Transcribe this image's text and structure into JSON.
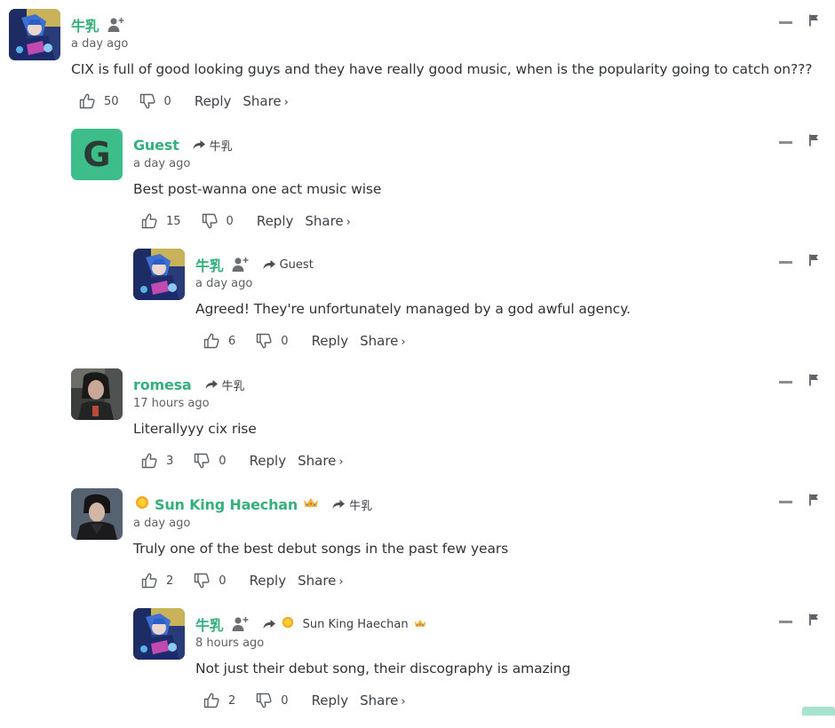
{
  "comments": [
    {
      "name": "牛乳",
      "time": "a day ago",
      "text": "CIX is full of good looking guys and they have really good music, when is the popularity going to catch on???",
      "likes": "50",
      "dislikes": "0",
      "reply": "Reply",
      "share": "Share"
    },
    {
      "avatar_letter": "G",
      "name": "Guest",
      "reply_to": "牛乳",
      "time": "a day ago",
      "text": "Best post-wanna one act music wise",
      "likes": "15",
      "dislikes": "0",
      "reply": "Reply",
      "share": "Share"
    },
    {
      "name": "牛乳",
      "reply_to": "Guest",
      "time": "a day ago",
      "text": "Agreed! They're unfortunately managed by a god awful agency.",
      "likes": "6",
      "dislikes": "0",
      "reply": "Reply",
      "share": "Share"
    },
    {
      "name": "romesa",
      "reply_to": "牛乳",
      "time": "17 hours ago",
      "text": "Literallyyy cix rise",
      "likes": "3",
      "dislikes": "0",
      "reply": "Reply",
      "share": "Share"
    },
    {
      "name": "Sun King Haechan",
      "reply_to": "牛乳",
      "time": "a day ago",
      "text": "Truly one of the best debut songs in the past few years",
      "likes": "2",
      "dislikes": "0",
      "reply": "Reply",
      "share": "Share"
    },
    {
      "name": "牛乳",
      "reply_to": "Sun King Haechan",
      "time": "8 hours ago",
      "text": "Not just their debut song, their discography is amazing",
      "likes": "2",
      "dislikes": "0",
      "reply": "Reply",
      "share": "Share"
    }
  ],
  "colors": {
    "username": "#35b07c",
    "guest_avatar": "#3dbd8a"
  },
  "icons": [
    "add-user-icon",
    "reply-arrow-icon",
    "thumbs-up-icon",
    "thumbs-down-icon",
    "collapse-icon",
    "flag-icon",
    "sun-icon",
    "crown-icon"
  ]
}
